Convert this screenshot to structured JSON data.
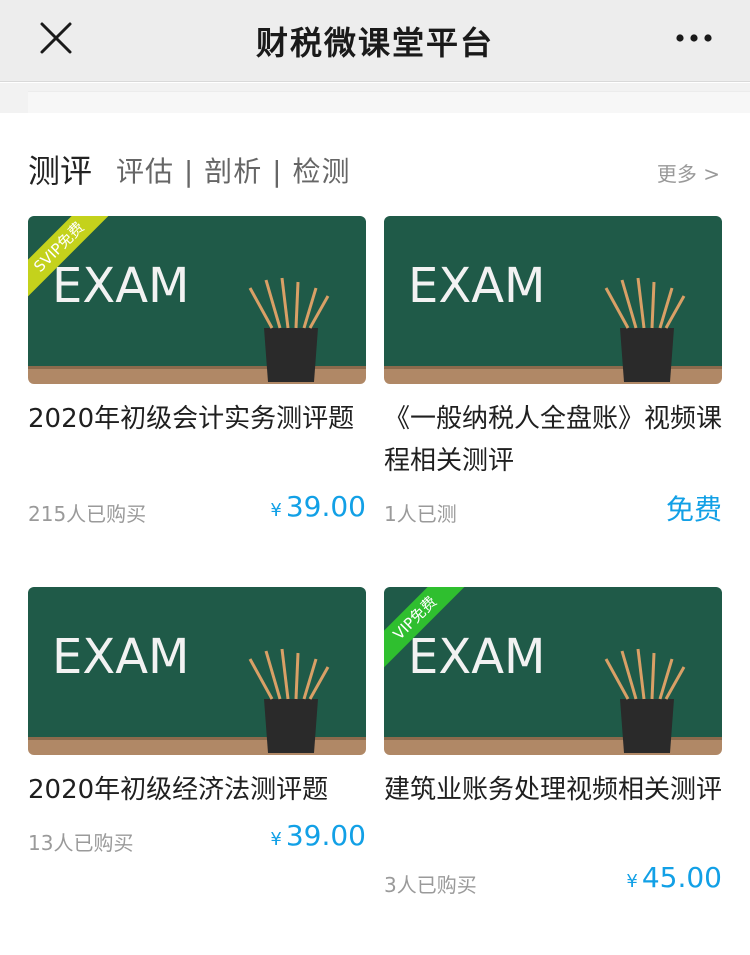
{
  "header": {
    "title": "财税微课堂平台",
    "close_icon": "close-icon",
    "more_icon": "more-dots-icon"
  },
  "section": {
    "title": "测评",
    "tags": "评估 | 剖析 | 检测",
    "more": "更多 >"
  },
  "cards": [
    {
      "thumb_text": "EXAM",
      "badge": "SVIP免费",
      "title": "2020年初级会计实务测评题",
      "sold": "215人已购买",
      "currency": "¥",
      "price": "39.00"
    },
    {
      "thumb_text": "EXAM",
      "title": "《一般纳税人全盘账》视频课程相关测评",
      "sold": "1人已测",
      "price_label": "免费"
    },
    {
      "thumb_text": "EXAM",
      "title": "2020年初级经济法测评题",
      "sold": "13人已购买",
      "currency": "¥",
      "price": "39.00"
    },
    {
      "thumb_text": "EXAM",
      "badge": "VIP免费",
      "title": "建筑业账务处理视频相关测评",
      "sold": "3人已购买",
      "currency": "¥",
      "price": "45.00"
    }
  ],
  "colors": {
    "accent": "#12a0e6",
    "chalkboard": "#1f5a48",
    "svip_badge": "#c4d21c",
    "vip_badge": "#2fbf2f"
  }
}
